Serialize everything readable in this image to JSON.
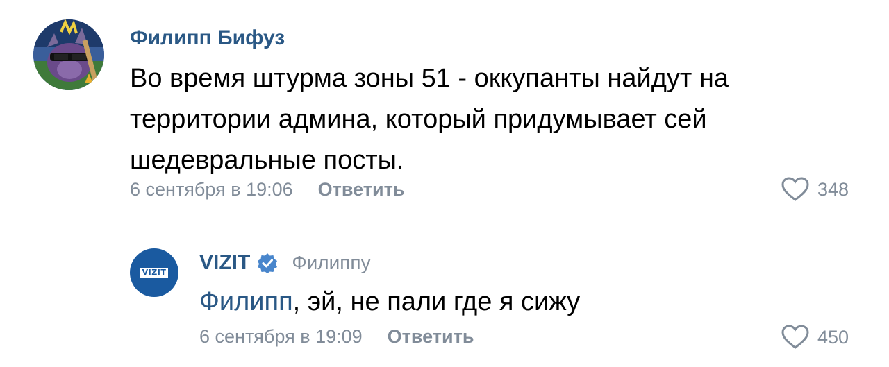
{
  "comments": [
    {
      "author": "Филипп Бифуз",
      "text": "Во время штурма зоны 51 - оккупанты найдут на территории админа, который придумывает сей шедевральные посты.",
      "timestamp": "6 сентября в 19:06",
      "reply_label": "Ответить",
      "likes": "348",
      "avatar_icon": "cartoon-dragon-avatar"
    },
    {
      "author": "VIZIT",
      "verified_icon": "verified-checkmark-icon",
      "reply_to": "Филиппу",
      "mention": "Филипп",
      "text": ", эй, не пали где я сижу",
      "timestamp": "6 сентября в 19:09",
      "reply_label": "Ответить",
      "likes": "450",
      "avatar_logo_text": "VIZIT"
    }
  ],
  "colors": {
    "link": "#2a5885",
    "meta": "#818c99",
    "verified": "#4986cc",
    "vizit_brand": "#1a5aa0"
  },
  "icons": {
    "like": "heart-outline-icon"
  }
}
